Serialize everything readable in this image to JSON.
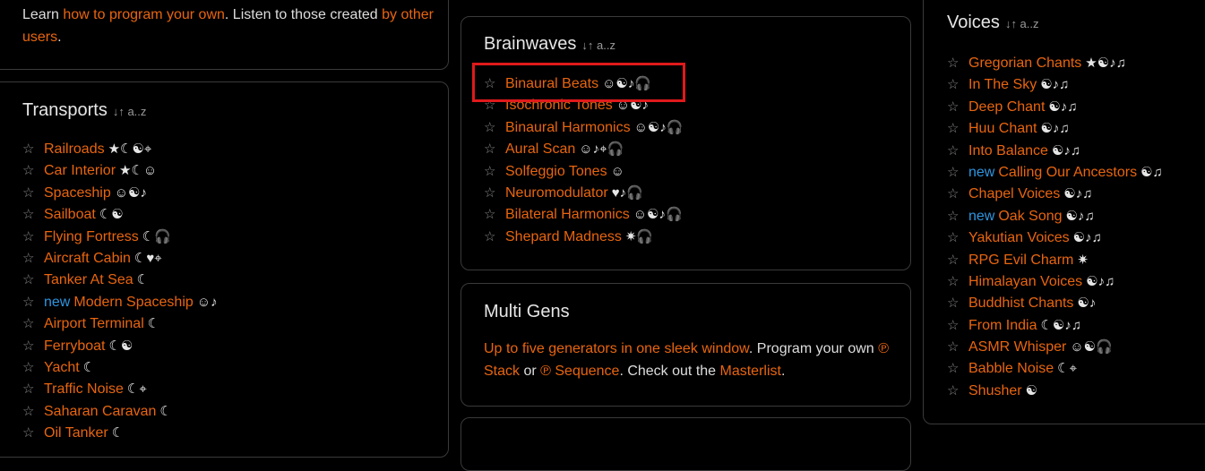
{
  "intro": {
    "text1": "Learn ",
    "link1": "how to program your own",
    "text2": ". Listen to those created ",
    "link2": "by other users",
    "text3": "."
  },
  "transports": {
    "title": "Transports",
    "sort": "↓↑ a..z",
    "items": [
      {
        "new": "",
        "name": "Railroads",
        "icons": "★☾☯⌖"
      },
      {
        "new": "",
        "name": "Car Interior",
        "icons": "★☾☺"
      },
      {
        "new": "",
        "name": "Spaceship",
        "icons": "☺☯♪"
      },
      {
        "new": "",
        "name": "Sailboat",
        "icons": "☾☯"
      },
      {
        "new": "",
        "name": "Flying Fortress",
        "icons": "☾🎧"
      },
      {
        "new": "",
        "name": "Aircraft Cabin",
        "icons": "☾♥⌖"
      },
      {
        "new": "",
        "name": "Tanker At Sea",
        "icons": "☾"
      },
      {
        "new": "new",
        "name": "Modern Spaceship",
        "icons": "☺♪"
      },
      {
        "new": "",
        "name": "Airport Terminal",
        "icons": "☾"
      },
      {
        "new": "",
        "name": "Ferryboat",
        "icons": "☾☯"
      },
      {
        "new": "",
        "name": "Yacht",
        "icons": "☾"
      },
      {
        "new": "",
        "name": "Traffic Noise",
        "icons": "☾⌖"
      },
      {
        "new": "",
        "name": "Saharan Caravan",
        "icons": "☾"
      },
      {
        "new": "",
        "name": "Oil Tanker",
        "icons": "☾"
      }
    ]
  },
  "brainwaves": {
    "title": "Brainwaves",
    "sort": "↓↑ a..z",
    "items": [
      {
        "name": "Binaural Beats",
        "icons": "☺☯♪🎧"
      },
      {
        "name": "Isochronic Tones",
        "icons": "☺☯♪"
      },
      {
        "name": "Binaural Harmonics",
        "icons": "☺☯♪🎧"
      },
      {
        "name": "Aural Scan",
        "icons": "☺♪⌖🎧"
      },
      {
        "name": "Solfeggio Tones",
        "icons": "☺"
      },
      {
        "name": "Neuromodulator",
        "icons": "♥♪🎧"
      },
      {
        "name": "Bilateral Harmonics",
        "icons": "☺☯♪🎧"
      },
      {
        "name": "Shepard Madness",
        "icons": "✷🎧"
      }
    ]
  },
  "multigens": {
    "title": "Multi Gens",
    "link1": "Up to five generators in one sleek window",
    "text1": ". Program your own ",
    "link2": "℗ Stack",
    "text2": " or ",
    "link3": "℗ Sequence",
    "text3": ". Check out the ",
    "link4": "Masterlist",
    "text4": "."
  },
  "voices": {
    "title": "Voices",
    "sort": "↓↑ a..z",
    "items": [
      {
        "new": "",
        "name": "Gregorian Chants",
        "icons": "★☯♪♫"
      },
      {
        "new": "",
        "name": "In The Sky",
        "icons": "☯♪♫"
      },
      {
        "new": "",
        "name": "Deep Chant",
        "icons": "☯♪♫"
      },
      {
        "new": "",
        "name": "Huu Chant",
        "icons": "☯♪♫"
      },
      {
        "new": "",
        "name": "Into Balance",
        "icons": "☯♪♫"
      },
      {
        "new": "new",
        "name": "Calling Our Ancestors",
        "icons": "☯♫"
      },
      {
        "new": "",
        "name": "Chapel Voices",
        "icons": "☯♪♫"
      },
      {
        "new": "new",
        "name": "Oak Song",
        "icons": "☯♪♫"
      },
      {
        "new": "",
        "name": "Yakutian Voices",
        "icons": "☯♪♫"
      },
      {
        "new": "",
        "name": "RPG Evil Charm",
        "icons": "✷"
      },
      {
        "new": "",
        "name": "Himalayan Voices",
        "icons": "☯♪♫"
      },
      {
        "new": "",
        "name": "Buddhist Chants",
        "icons": "☯♪"
      },
      {
        "new": "",
        "name": "From India",
        "icons": "☾☯♪♫"
      },
      {
        "new": "",
        "name": "ASMR Whisper",
        "icons": "☺☯🎧"
      },
      {
        "new": "",
        "name": "Babble Noise",
        "icons": "☾⌖"
      },
      {
        "new": "",
        "name": "Shusher",
        "icons": "☯"
      }
    ]
  }
}
